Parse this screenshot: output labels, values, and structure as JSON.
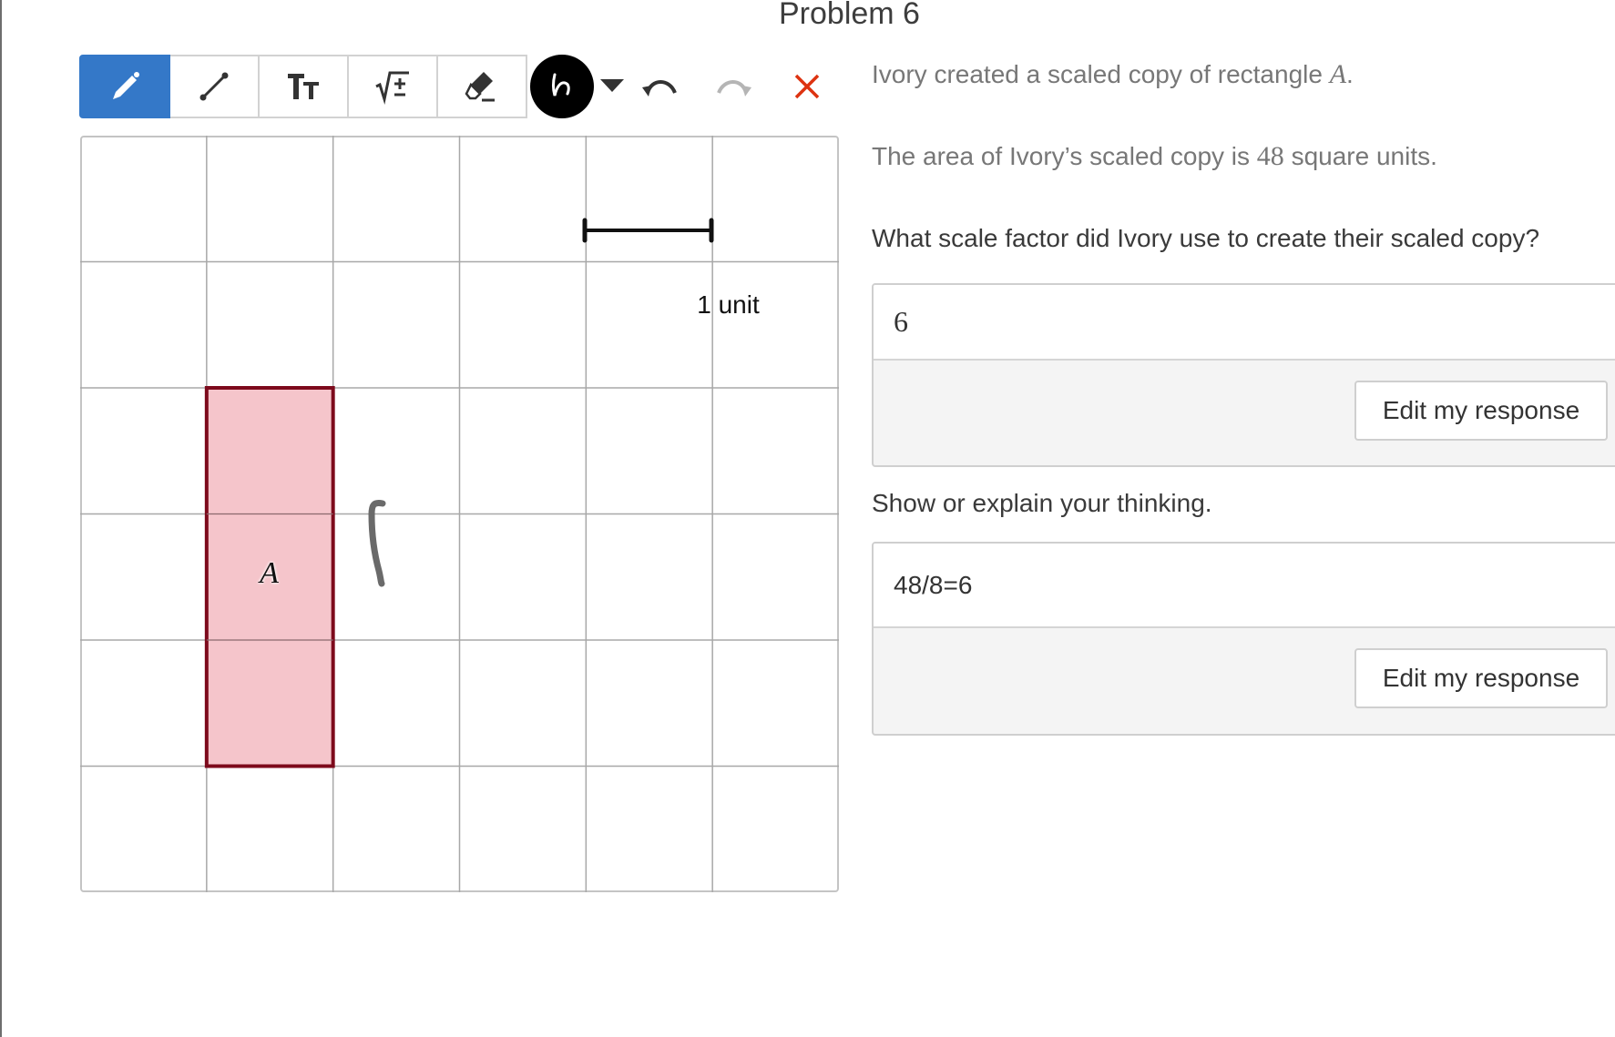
{
  "page": {
    "title": "Problem 6"
  },
  "toolbar": {
    "tools": [
      {
        "name": "pencil-tool",
        "icon": "pencil-icon",
        "active": true
      },
      {
        "name": "line-tool",
        "icon": "line-segment-icon",
        "active": false
      },
      {
        "name": "text-tool",
        "icon": "text-size-icon",
        "active": false
      },
      {
        "name": "math-tool",
        "icon": "sqrt-plus-minus-icon",
        "active": false
      },
      {
        "name": "eraser-tool",
        "icon": "eraser-icon",
        "active": false
      }
    ],
    "color_picker": {
      "icon": "squiggle-icon",
      "color": "#000000"
    },
    "dropdown_icon": "caret-down-icon",
    "undo_icon": "undo-icon",
    "redo_icon": "redo-icon",
    "clear_icon": "close-icon",
    "active_color": "#3478c8",
    "clear_color": "#dd3311"
  },
  "canvas": {
    "grid_columns": 6,
    "grid_rows": 6,
    "unit_label": "1 unit",
    "rectangle": {
      "label": "A",
      "col": 1,
      "row": 2,
      "width_units": 1,
      "height_units": 3,
      "fill": "#f4c2c8",
      "stroke": "#7d0a1c"
    },
    "drawing_stroke_color": "#6a6a6a"
  },
  "question": {
    "line1_text": "Ivory created a scaled copy of rectangle",
    "line1_math": "A",
    "line1_end": ".",
    "line2_text": "The area of Ivory’s scaled copy is",
    "line2_math": "48",
    "line2_end": "square units.",
    "prompt": "What scale factor did Ivory use to create their scaled copy?",
    "thinking_prompt": "Show or explain your thinking."
  },
  "responses": [
    {
      "value": "6",
      "edit_label": "Edit my response"
    },
    {
      "value": "48/8=6",
      "edit_label": "Edit my response"
    }
  ]
}
